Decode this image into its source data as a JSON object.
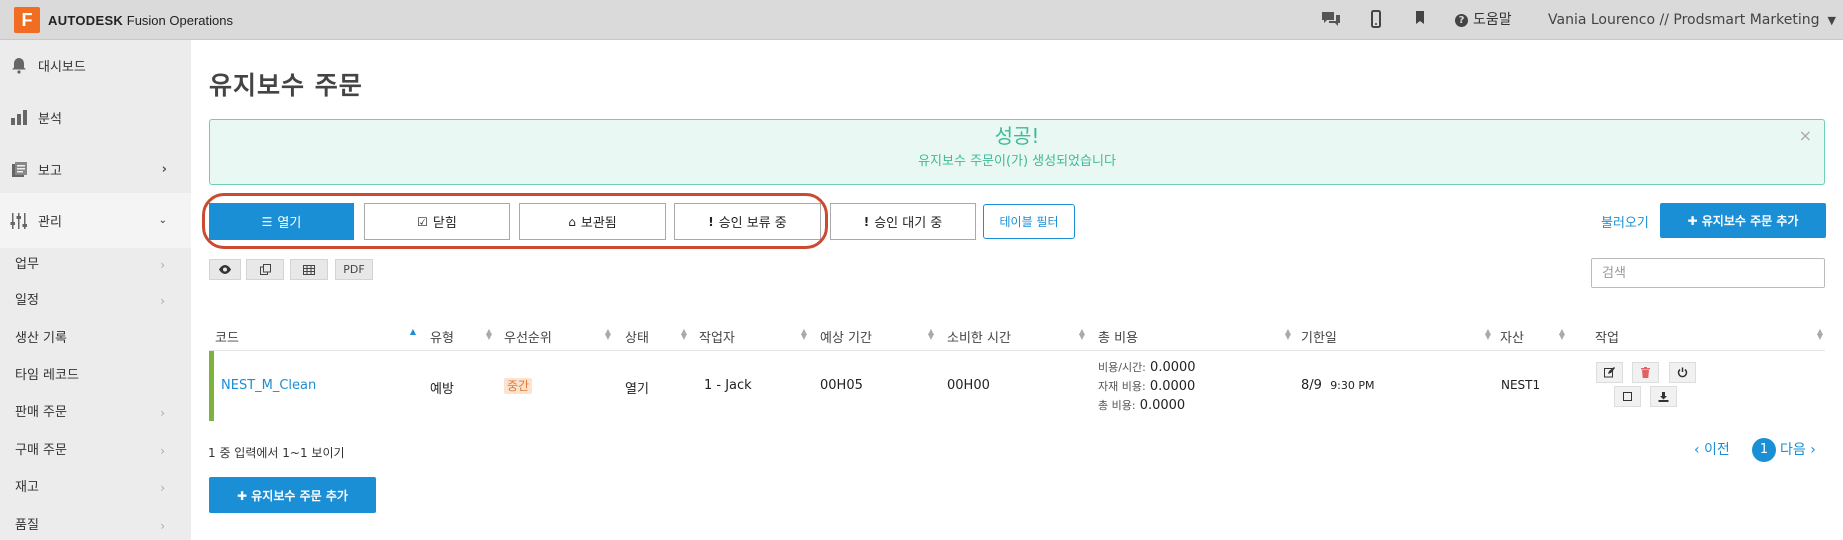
{
  "header": {
    "logo_letter": "F",
    "brand": "AUTODESK",
    "product": "Fusion Operations",
    "help_label": "도움말",
    "user_label": "Vania Lourenco // Prodsmart Marketing",
    "icons": [
      "chat-icon",
      "mobile-icon",
      "bookmark-icon",
      "help-icon"
    ]
  },
  "sidebar": {
    "items": [
      {
        "label": "대시보드",
        "icon": "bell-icon"
      },
      {
        "label": "분석",
        "icon": "bar-chart-icon"
      },
      {
        "label": "보고",
        "icon": "report-icon"
      },
      {
        "label": "관리",
        "icon": "sliders-icon"
      }
    ],
    "sub_items": [
      {
        "label": "업무"
      },
      {
        "label": "일정"
      },
      {
        "label": "생산 기록"
      },
      {
        "label": "타임 레코드"
      },
      {
        "label": "판매 주문"
      },
      {
        "label": "구매 주문"
      },
      {
        "label": "재고"
      },
      {
        "label": "품질"
      }
    ]
  },
  "page": {
    "title": "유지보수 주문"
  },
  "alert": {
    "title": "성공!",
    "message": "유지보수 주문이(가) 생성되었습니다",
    "close": "×"
  },
  "tabs": [
    {
      "label": "열기",
      "icon": "☰",
      "active": true
    },
    {
      "label": "닫힘",
      "icon": "☑",
      "active": false
    },
    {
      "label": "보관됨",
      "icon": "⌂",
      "active": false
    },
    {
      "label": "승인 보류 중",
      "icon": "!",
      "active": false
    },
    {
      "label": "승인 대기 중",
      "icon": "!",
      "active": false
    }
  ],
  "table_filter_label": "테이블 필터",
  "load_label": "불러오기",
  "add_button_label": "✚ 유지보수 주문 추가",
  "toolbar": {
    "view_icon": "eye-icon",
    "copy_icon": "copy-icon",
    "table_icon": "table-icon",
    "pdf_label": "PDF"
  },
  "search": {
    "placeholder": "검색",
    "value": ""
  },
  "table": {
    "columns": [
      "코드",
      "유형",
      "우선순위",
      "상태",
      "작업자",
      "예상 기간",
      "소비한 시간",
      "총 비용",
      "기한일",
      "자산",
      "작업"
    ],
    "rows": [
      {
        "code": "NEST_M_Clean",
        "type": "예방",
        "priority": "중간",
        "status": "열기",
        "worker": "1 - Jack",
        "expected": "00H05",
        "consumed": "00H00",
        "cost_per_hour_label": "비용/시간:",
        "cost_per_hour": "0.0000",
        "material_cost_label": "자재 비용:",
        "material_cost": "0.0000",
        "total_cost_label": "총 비용:",
        "total_cost": "0.0000",
        "due_date": "8/9",
        "due_time": "9:30 PM",
        "asset": "NEST1"
      }
    ]
  },
  "pagination": {
    "summary": "1 중 입력에서 1~1 보이기",
    "prev": "‹ 이전",
    "page": "1",
    "next": "다음 ›"
  },
  "colors": {
    "accent": "#1a8fd6",
    "success": "#3dbb96",
    "highlight": "#cc4a32",
    "row_status": "#7db33c",
    "brand": "#f06d22"
  }
}
